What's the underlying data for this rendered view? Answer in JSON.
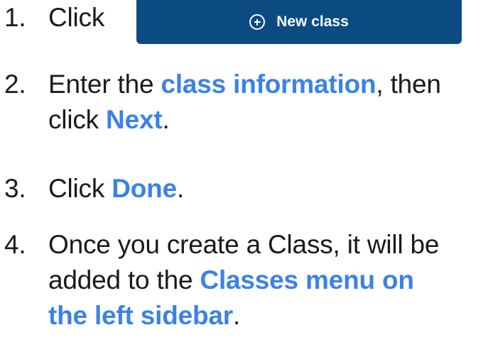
{
  "steps": [
    {
      "number": "1.",
      "text": "Click"
    },
    {
      "number": "2.",
      "prefix": "Enter the",
      "highlight": "class information",
      "middle": ", then",
      "line2_prefix": "click",
      "highlight2": "Next",
      "suffix": "."
    },
    {
      "number": "3.",
      "prefix": "Click",
      "highlight": "Done",
      "suffix": "."
    },
    {
      "number": "4.",
      "line1": "Once you create a Class, it will be",
      "line2_prefix": "added to the",
      "highlight_line2": "Classes menu on",
      "highlight_line3": "the left sidebar",
      "suffix": "."
    }
  ],
  "new_class_button": {
    "label": "New class",
    "icon": "plus-circle-icon"
  },
  "colors": {
    "highlight": "#3b82e6",
    "button_bg": "#0c4a82",
    "text": "#1a1a1a"
  }
}
